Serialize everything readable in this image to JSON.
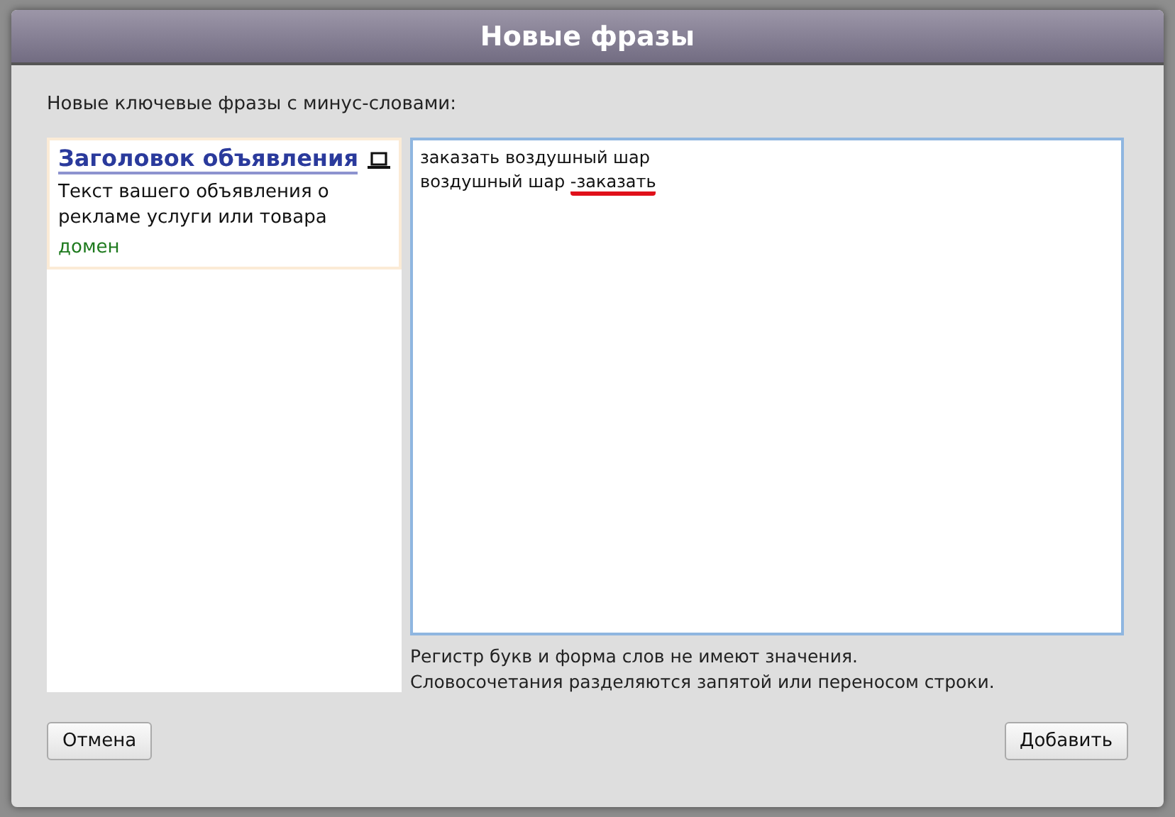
{
  "dialog": {
    "title": "Новые фразы",
    "intro": "Новые ключевые фразы с минус-словами:",
    "ad_preview": {
      "title": "Заголовок объявления",
      "text": "Текст вашего объявления о рекламе услуги или товара",
      "domain": "домен"
    },
    "phrases_field": {
      "lines": [
        [
          {
            "text": "заказать воздушный шар",
            "flagged": false
          }
        ],
        [
          {
            "text": "воздушный шар ",
            "flagged": false
          },
          {
            "text": "-заказать",
            "flagged": true
          }
        ]
      ]
    },
    "hints": [
      "Регистр букв и форма слов не имеют значения.",
      "Словосочетания разделяются запятой или переносом строки."
    ],
    "buttons": [
      "Отмена",
      "Добавить"
    ]
  }
}
